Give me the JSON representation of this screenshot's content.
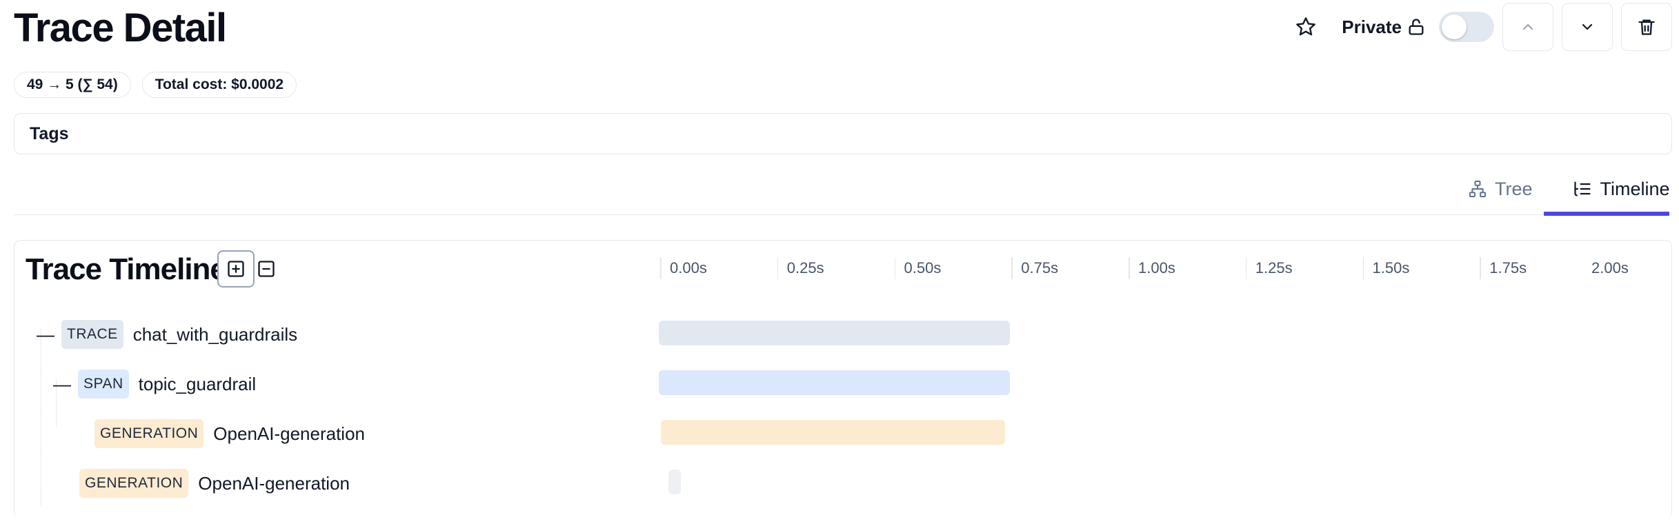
{
  "header": {
    "title": "Trace Detail",
    "private_label": "Private",
    "private_enabled": false
  },
  "usage": {
    "tokens": "49 → 5 (∑ 54)",
    "total_cost": "Total cost: $0.0002"
  },
  "tags": {
    "label": "Tags"
  },
  "tabs": {
    "tree": "Tree",
    "timeline": "Timeline",
    "active": "Timeline"
  },
  "timeline": {
    "title": "Trace Timeline",
    "axis_ticks": [
      "0.00s",
      "0.25s",
      "0.50s",
      "0.75s",
      "1.00s",
      "1.25s",
      "1.50s",
      "1.75s",
      "2.00s"
    ],
    "axis_max_seconds": 2.0,
    "rows": [
      {
        "type": "TRACE",
        "name": "chat_with_guardrails",
        "depth": 0,
        "collapsible": true,
        "start_s": 0.0,
        "end_s": 0.75
      },
      {
        "type": "SPAN",
        "name": "topic_guardrail",
        "depth": 1,
        "collapsible": true,
        "start_s": 0.0,
        "end_s": 0.75
      },
      {
        "type": "GENERATION",
        "name": "OpenAI-generation",
        "depth": 2,
        "collapsible": false,
        "start_s": 0.005,
        "end_s": 0.74
      },
      {
        "type": "GENERATION",
        "name": "OpenAI-generation",
        "depth": 1,
        "collapsible": false,
        "start_s": 0.02,
        "end_s": 0.045
      }
    ]
  },
  "colors": {
    "accent": "#4f46e5",
    "trace": "#e2e8f0",
    "span": "#dbeafe",
    "generation": "#fdebd2"
  }
}
